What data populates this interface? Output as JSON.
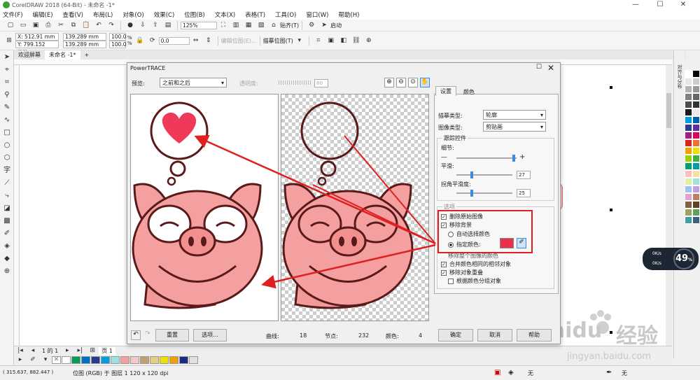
{
  "window": {
    "title": "CorelDRAW 2018 (64-Bit) - 未命名 -1*"
  },
  "menu": [
    "文件(F)",
    "编辑(E)",
    "查看(V)",
    "布局(L)",
    "对象(O)",
    "效果(C)",
    "位图(B)",
    "文本(X)",
    "表格(T)",
    "工具(O)",
    "窗口(W)",
    "帮助(H)"
  ],
  "toolbar1": {
    "zoom": "125%",
    "snap_label": "贴齐(T)",
    "launch_label": "启动"
  },
  "propbar": {
    "x": "X: 512.91 mm",
    "y": "Y: 799.152 mm",
    "w": "139.289 mm",
    "h": "139.289 mm",
    "sx": "100.0",
    "sy": "100.0",
    "unit": "%",
    "angle": "0.0",
    "edit_bitmap": "编辑位图(E)...",
    "trace_bitmap": "描摹位图(T)"
  },
  "doc_tabs": [
    "欢迎屏幕",
    "未命名 -1*"
  ],
  "dialog": {
    "title": "PowerTRACE",
    "preview_label": "预览:",
    "preview_mode": "之前和之后",
    "transparency_label": "透明度:",
    "transparency_value": "80",
    "tabs": [
      "设置",
      "颜色"
    ],
    "trace_type_label": "描摹类型:",
    "trace_type": "轮廓",
    "image_type_label": "图像类型:",
    "image_type": "剪贴画",
    "group_controls": "跟踪控件",
    "detail_label": "细节:",
    "smooth_label": "平滑:",
    "smooth_value": "27",
    "corner_label": "拐角平滑度:",
    "corner_value": "25",
    "group_options": "选项",
    "opt_delete_original": "删除原始图像",
    "opt_remove_bg": "移除背景",
    "opt_auto_color": "自动选择颜色",
    "opt_specify_color": "指定颜色:",
    "opt_remove_whole": "移除整个图像的颜色",
    "opt_merge_adjacent": "合并颜色相同的相邻对象",
    "opt_remove_overlap": "移除对象重叠",
    "opt_group_by_color": "根据颜色分组对象",
    "reset_btn": "重置",
    "options_btn": "选项...",
    "curves_label": "曲线:",
    "curves": "18",
    "nodes_label": "节点:",
    "nodes": "232",
    "colors_label": "颜色:",
    "colors": "4",
    "ok_btn": "确定",
    "cancel_btn": "取消",
    "help_btn": "帮助"
  },
  "pagebar": {
    "page_num": "1 的 1",
    "page_tab": "页 1"
  },
  "status": {
    "coords": "( 315.637, 882.447 )",
    "info": "位图 (RGB) 于 图层 1 120 x 120 dpi",
    "fill_none": "无",
    "outline_none": "无"
  },
  "docker_title": "对齐与分布",
  "netmon": {
    "percent": "49",
    "unit": "%",
    "up": "0K/s",
    "down": "0K/s"
  },
  "watermark": {
    "brand": "Baidu",
    "jingyan": "经验",
    "url": "jingyan.baidu.com"
  },
  "colors": {
    "accent": "#3c8de0",
    "specify_color": "#e8304a",
    "highlight": "#e02020",
    "heart": "#f0385a",
    "pig": "#f5a0a0"
  },
  "palette": [
    "#ffffff",
    "#000000",
    "#e6e6e6",
    "#cccccc",
    "#b3b3b3",
    "#999999",
    "#808080",
    "#666666",
    "#4d4d4d",
    "#333333",
    "#1a1a1a",
    "#f2e6e6",
    "#00a0e0",
    "#0060b0",
    "#2a3a90",
    "#6030a0",
    "#a02080",
    "#e00060",
    "#e02020",
    "#f07030",
    "#f0a000",
    "#f0e000",
    "#a0d000",
    "#40b040",
    "#00a070",
    "#00a0a0",
    "#f8c0c0",
    "#f8e0a0",
    "#e0f0a0",
    "#a0e0e0",
    "#a0c0f0",
    "#c0a0e0",
    "#e0a0d0",
    "#c08060",
    "#806040",
    "#604020",
    "#a0a060",
    "#60a060",
    "#40a0a0",
    "#406080"
  ],
  "doc_palette": [
    "#ffffff",
    "#00a050",
    "#0070c0",
    "#2a3a90",
    "#00a0e0",
    "#a0e0e0",
    "#f0a0a0",
    "#f8c8c8",
    "#c0a070",
    "#e0d080",
    "#f0e000",
    "#f0a000",
    "#1a2a80",
    "#e0e0e0"
  ]
}
